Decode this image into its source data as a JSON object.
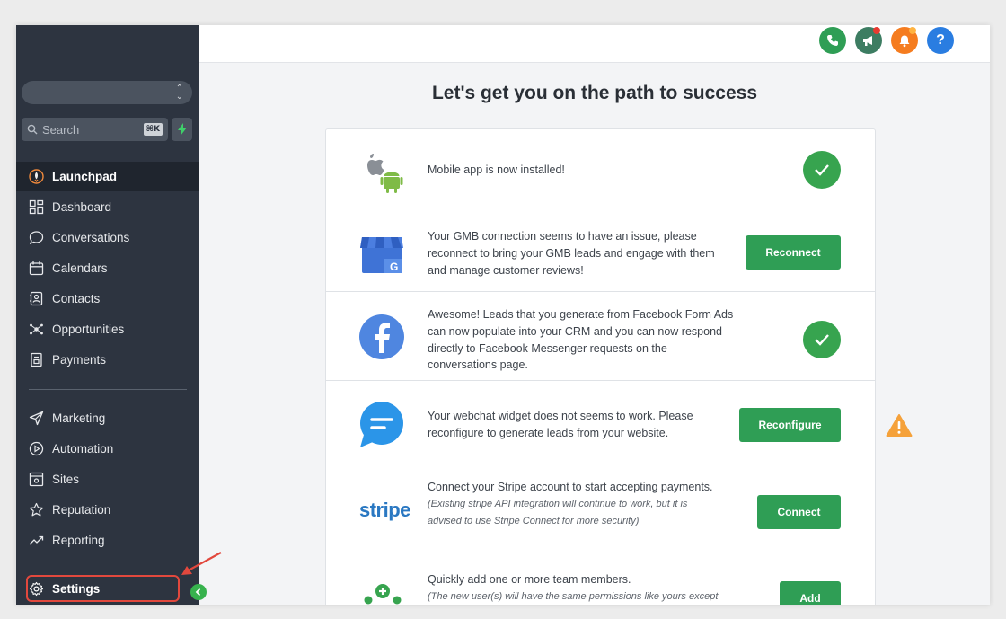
{
  "sidebar": {
    "search": {
      "placeholder": "Search",
      "shortcut": "⌘K"
    },
    "nav_items": [
      {
        "label": "Launchpad",
        "icon": "launchpad-icon",
        "active": true
      },
      {
        "label": "Dashboard",
        "icon": "dashboard-icon"
      },
      {
        "label": "Conversations",
        "icon": "chat-bubble-icon"
      },
      {
        "label": "Calendars",
        "icon": "calendar-icon"
      },
      {
        "label": "Contacts",
        "icon": "contacts-icon"
      },
      {
        "label": "Opportunities",
        "icon": "opportunities-icon"
      },
      {
        "label": "Payments",
        "icon": "payments-icon"
      }
    ],
    "nav_items_secondary": [
      {
        "label": "Marketing",
        "icon": "send-icon"
      },
      {
        "label": "Automation",
        "icon": "play-circle-icon"
      },
      {
        "label": "Sites",
        "icon": "sites-icon"
      },
      {
        "label": "Reputation",
        "icon": "star-icon"
      },
      {
        "label": "Reporting",
        "icon": "trend-icon"
      }
    ],
    "settings": {
      "label": "Settings",
      "icon": "gear-icon"
    }
  },
  "topbar": {
    "icons": [
      "phone-icon",
      "megaphone-icon",
      "bell-icon",
      "help-icon"
    ],
    "colors": {
      "phone": "#2f9e55",
      "megaphone": "#3d7d62",
      "bell": "#f57c1f",
      "help": "#2a7de1"
    }
  },
  "main": {
    "title": "Let's get you on the path to success",
    "cards": [
      {
        "text": "Mobile app is now installed!",
        "status": "done"
      },
      {
        "text": "Your GMB connection seems to have an issue, please reconnect to bring your GMB leads and engage with them and manage customer reviews!",
        "action": "Reconnect"
      },
      {
        "text": "Awesome! Leads that you generate from Facebook Form Ads can now populate into your CRM and you can now respond directly to Facebook Messenger requests on the conversations page.",
        "status": "done"
      },
      {
        "text": "Your webchat widget does not seems to work. Please reconfigure to generate leads from your website.",
        "action": "Reconfigure",
        "warning": true
      },
      {
        "text": "Connect your Stripe account to start accepting payments.",
        "note": "(Existing stripe API integration will continue to work, but it is advised to use Stripe Connect for more security)",
        "action": "Connect",
        "logo_text": "stripe"
      },
      {
        "text": "Quickly add one or more team members.",
        "note": "(The new user(s) will have the same permissions like yours except",
        "action": "Add"
      }
    ]
  },
  "colors": {
    "sidebar_bg": "#2d3440",
    "accent_green": "#2f9e55",
    "warning_orange": "#f5a13a",
    "annotation_red": "#e2483d"
  }
}
